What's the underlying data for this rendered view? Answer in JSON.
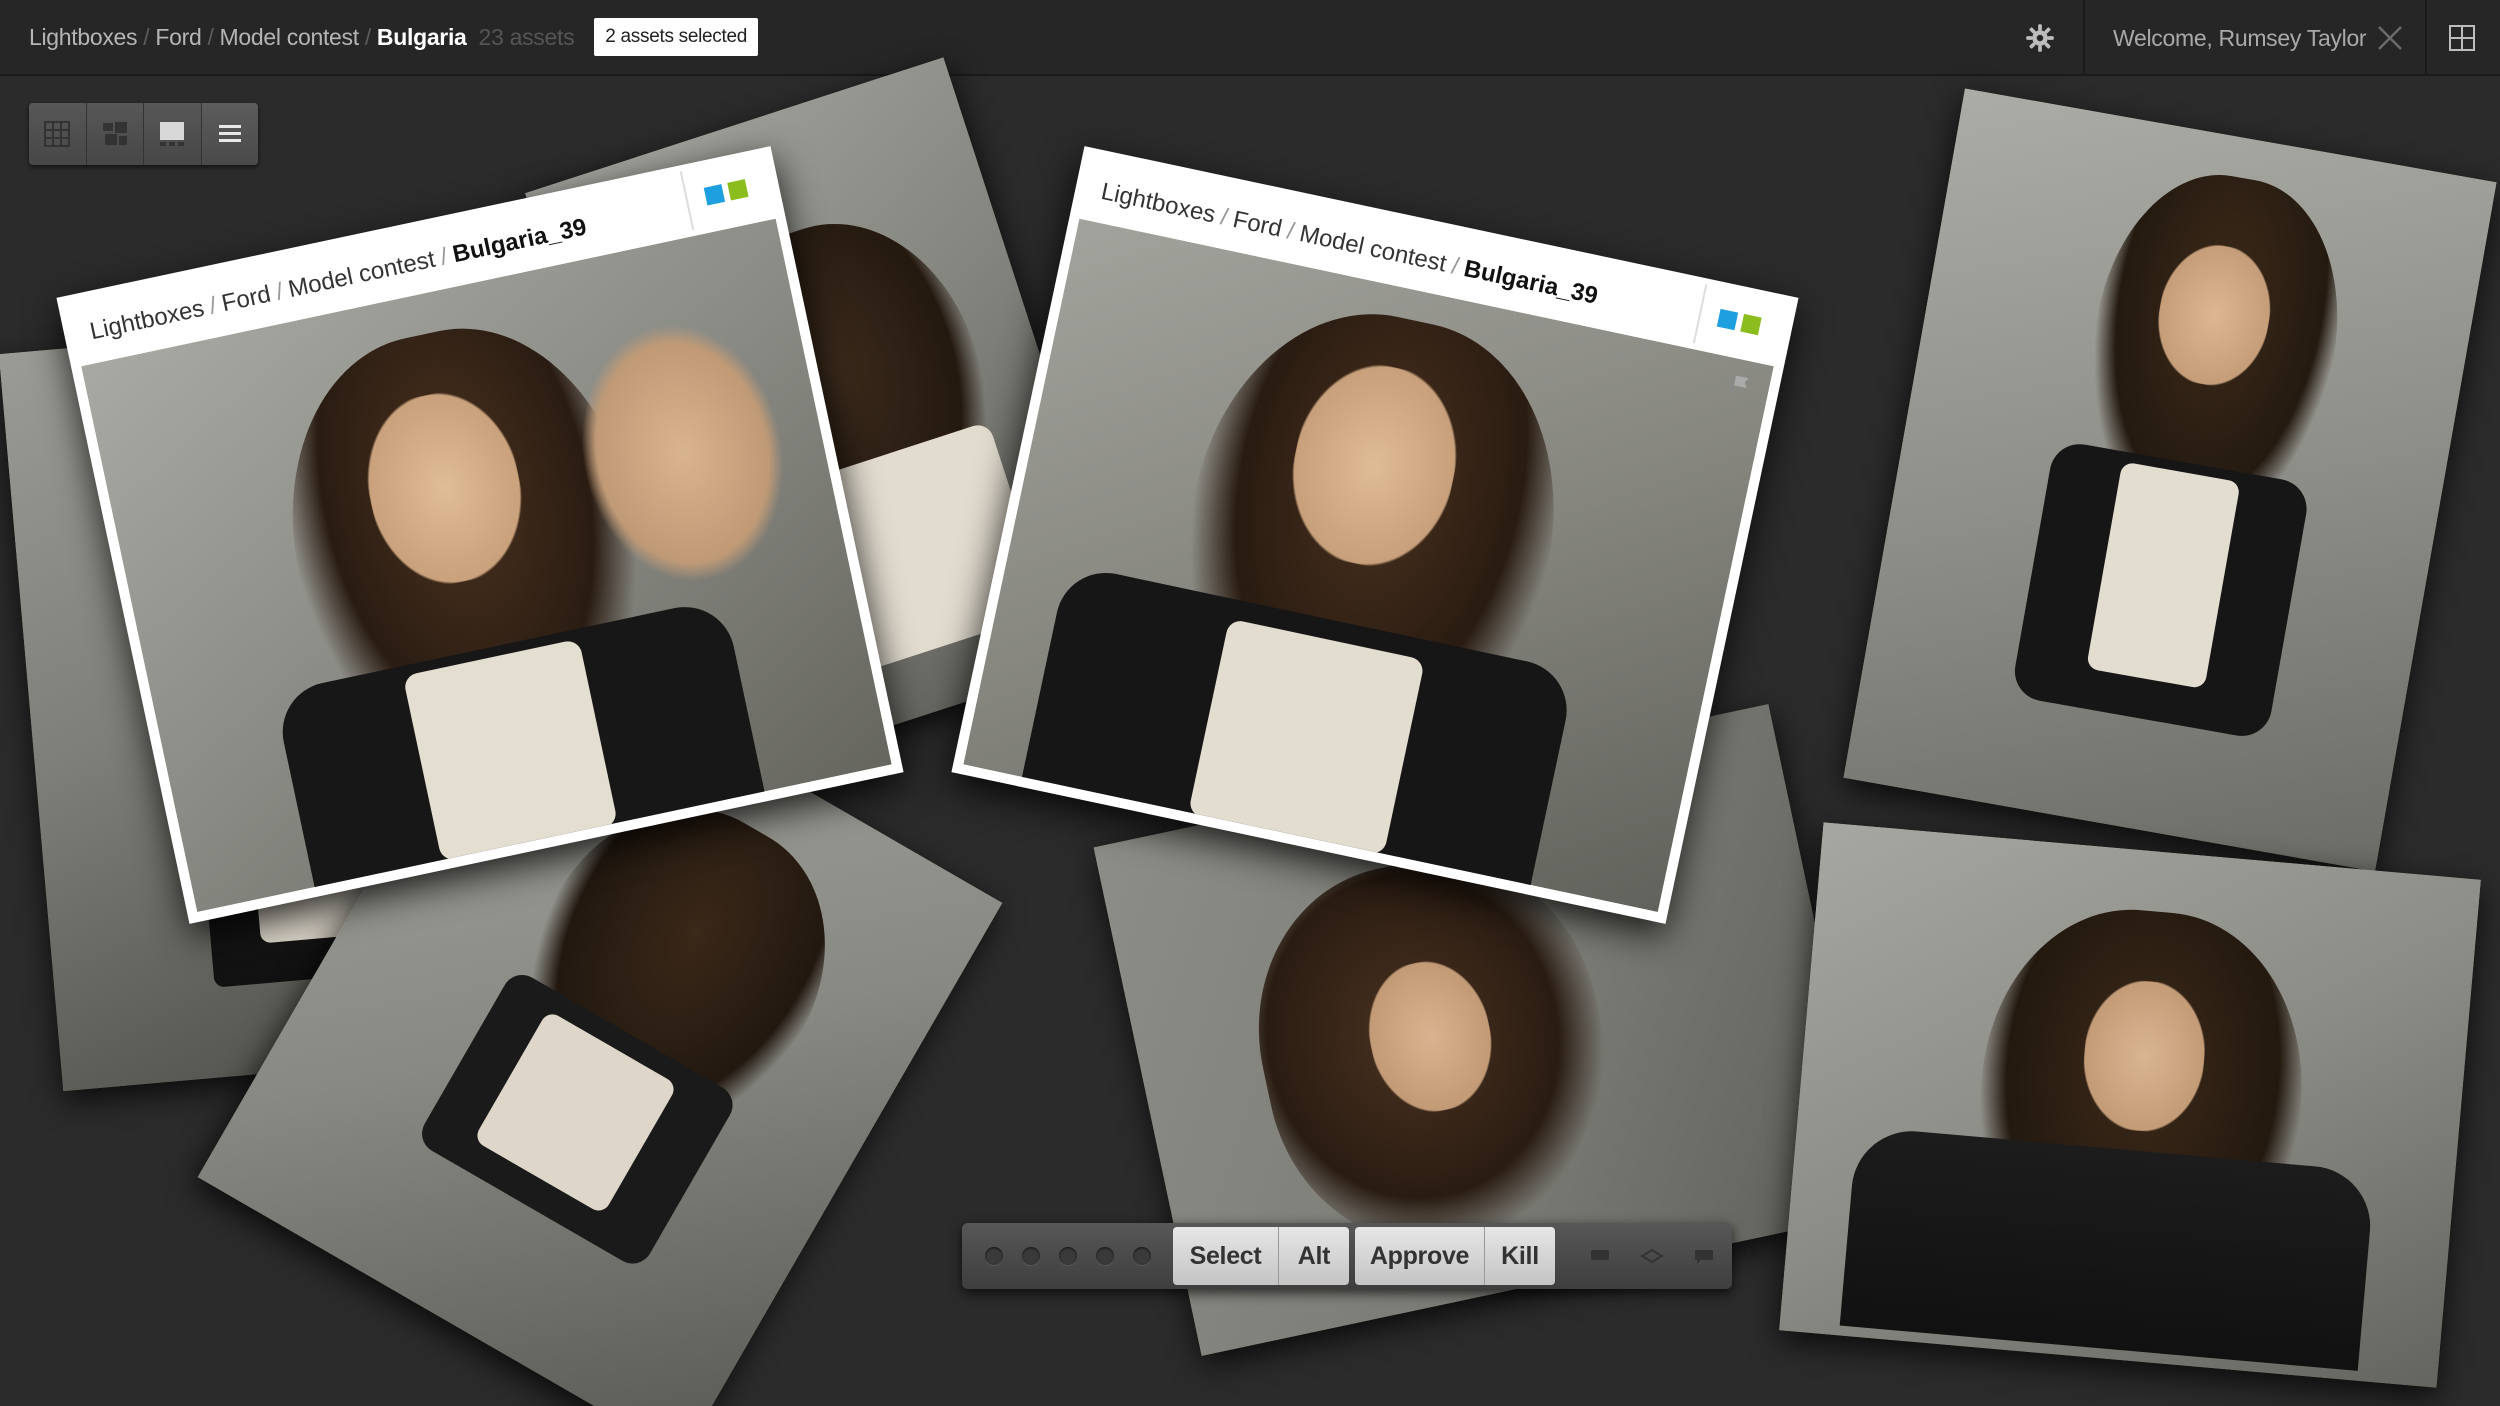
{
  "breadcrumb": {
    "items": [
      "Lightboxes",
      "Ford",
      "Model contest"
    ],
    "current": "Bulgaria",
    "count": "23 assets",
    "separator": "/"
  },
  "selection_badge": "2 assets selected",
  "user": {
    "welcome": "Welcome, Rumsey Taylor"
  },
  "icons": {
    "settings": "gear-icon",
    "close": "close-icon",
    "layout": "layout-grid-icon",
    "view_modes": [
      "grid-view-icon",
      "mosaic-view-icon",
      "filmstrip-view-icon",
      "list-view-icon"
    ],
    "flag": "flag-icon"
  },
  "selected_cards": [
    {
      "path": [
        "Lightboxes",
        "Ford",
        "Model contest"
      ],
      "name": "Bulgaria_39",
      "tags": [
        "#1e9fe0",
        "#8cbd1e"
      ]
    },
    {
      "path": [
        "Lightboxes",
        "Ford",
        "Model contest"
      ],
      "name": "Bulgaria_39",
      "tags": [
        "#1e9fe0",
        "#8cbd1e"
      ]
    }
  ],
  "actions": {
    "group1": [
      "Select",
      "Alt"
    ],
    "group2": [
      "Approve",
      "Kill"
    ],
    "rating_dots": 5,
    "extra_icons": [
      "comment-icon",
      "layers-icon",
      "chat-icon"
    ]
  },
  "colors": {
    "background": "#2b2b2b",
    "topbar": "#262626",
    "tag_blue": "#1e9fe0",
    "tag_green": "#8cbd1e"
  }
}
